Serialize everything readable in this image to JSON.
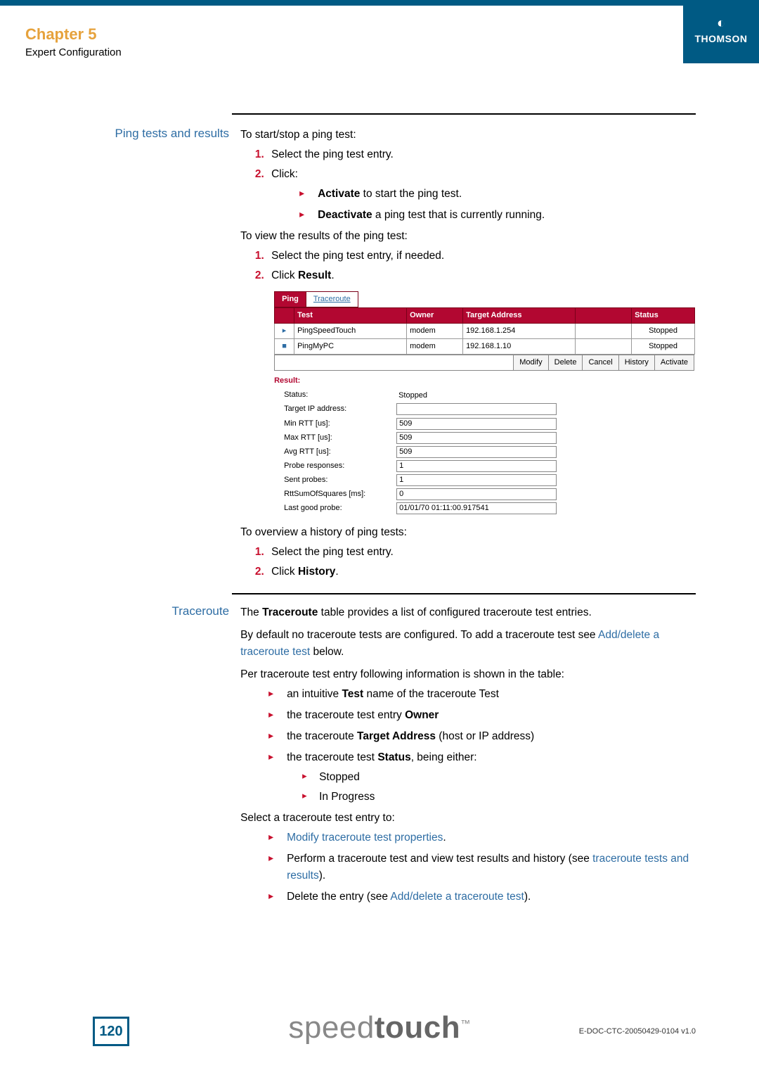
{
  "header": {
    "chapter": "Chapter 5",
    "subtitle": "Expert Configuration",
    "brand": "THOMSON"
  },
  "sec1": {
    "label": "Ping tests and results",
    "intro": "To start/stop a ping test:",
    "step1": "Select the ping test entry.",
    "step2": "Click:",
    "activate_b": "Activate",
    "activate_t": " to start the ping test.",
    "deactivate_b": "Deactivate",
    "deactivate_t": " a ping test that is currently running.",
    "view_intro": "To view the results of the ping test:",
    "view_step1": "Select the ping test entry, if needed.",
    "view_step2_a": "Click ",
    "view_step2_b": "Result",
    "view_step2_c": "."
  },
  "embed": {
    "tab_ping": "Ping",
    "tab_trace": "Traceroute",
    "th_blank": "",
    "th_test": "Test",
    "th_owner": "Owner",
    "th_target": "Target Address",
    "th_blank2": "",
    "th_status": "Status",
    "rows": [
      {
        "sel": "▸",
        "test": "PingSpeedTouch",
        "owner": "modem",
        "target": "192.168.1.254",
        "status": "Stopped"
      },
      {
        "sel": "■",
        "test": "PingMyPC",
        "owner": "modem",
        "target": "192.168.1.10",
        "status": "Stopped"
      }
    ],
    "buttons": {
      "modify": "Modify",
      "delete": "Delete",
      "cancel": "Cancel",
      "history": "History",
      "activate": "Activate"
    },
    "result_title": "Result:",
    "result": {
      "status_l": "Status:",
      "status_v": "Stopped",
      "target_l": "Target IP address:",
      "target_v": "",
      "min_l": "Min RTT [us]:",
      "min_v": "509",
      "max_l": "Max RTT [us]:",
      "max_v": "509",
      "avg_l": "Avg RTT [us]:",
      "avg_v": "509",
      "probe_l": "Probe responses:",
      "probe_v": "1",
      "sent_l": "Sent probes:",
      "sent_v": "1",
      "rtt_l": "RttSumOfSquares [ms]:",
      "rtt_v": "0",
      "last_l": "Last good probe:",
      "last_v": "01/01/70 01:11:00.917541"
    }
  },
  "history": {
    "intro": "To overview a history of ping tests:",
    "s1": "Select the ping test entry.",
    "s2a": "Click ",
    "s2b": "History",
    "s2c": "."
  },
  "trace": {
    "label": "Traceroute",
    "p1a": "The ",
    "p1b": "Traceroute",
    "p1c": " table provides a list of configured traceroute test entries.",
    "p2a": "By default no traceroute tests are configured. To add a traceroute test see ",
    "p2b": "Add/delete a traceroute test",
    "p2c": " below.",
    "p3": "Per traceroute test entry following information is shown in the table:",
    "li1a": "an intuitive ",
    "li1b": "Test",
    "li1c": " name of the traceroute Test",
    "li2a": "the traceroute test entry ",
    "li2b": "Owner",
    "li3a": "the traceroute ",
    "li3b": "Target Address",
    "li3c": " (host or IP address)",
    "li4a": "the traceroute test ",
    "li4b": "Status",
    "li4c": ", being either:",
    "li4_s1": "Stopped",
    "li4_s2": "In Progress",
    "p4": "Select a traceroute test entry to:",
    "a1": "Modify traceroute test properties",
    "a1_suf": ".",
    "a2_pre": "Perform a traceroute test and view test results and history (see ",
    "a2_link": "traceroute tests and results",
    "a2_suf": ").",
    "a3_pre": "Delete the entry (see ",
    "a3_link": "Add/delete a traceroute test",
    "a3_suf": ")."
  },
  "footer": {
    "page": "120",
    "brand1": "speed",
    "brand2": "touch",
    "tm": "™",
    "docid": "E-DOC-CTC-20050429-0104 v1.0"
  }
}
